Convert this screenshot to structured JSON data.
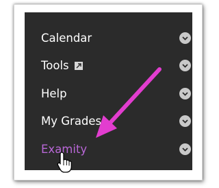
{
  "menu": {
    "items": [
      {
        "label": "Calendar"
      },
      {
        "label": "Tools",
        "icon": "external-link-icon"
      },
      {
        "label": "Help"
      },
      {
        "label": "My Grades"
      },
      {
        "label": "Examity",
        "active": true
      }
    ]
  },
  "colors": {
    "panel": "#2b2b2b",
    "text": "#ffffff",
    "active_text": "#b867d6",
    "arrow": "#e23dcf",
    "chevron": "#c9c9c9"
  }
}
